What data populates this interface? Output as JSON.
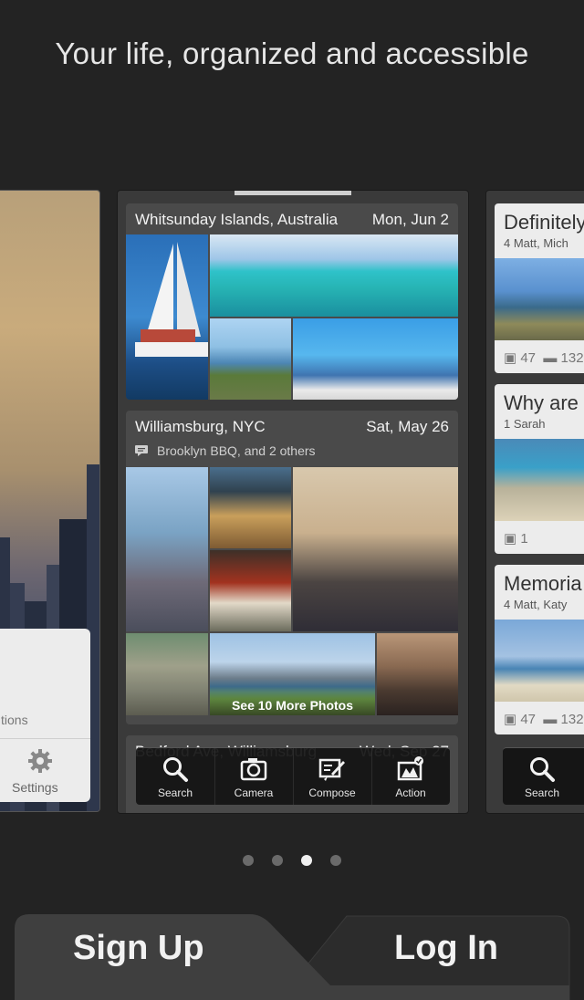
{
  "headline": "Your life, organized and accessible",
  "left_card": {
    "menu_partial_label": "tions",
    "settings_label": "Settings"
  },
  "moments": [
    {
      "location": "Whitsunday Islands, Australia",
      "date": "Mon, Jun 2"
    },
    {
      "location": "Williamsburg, NYC",
      "date": "Sat, May 26",
      "subtitle": "Brooklyn BBQ, and 2 others",
      "more_label": "See 10 More Photos"
    },
    {
      "location": "Bedford Ave, Williamsburg",
      "date": "Wed, Sep 27"
    }
  ],
  "toolbar": {
    "items": [
      {
        "label": "Search",
        "icon": "search-icon"
      },
      {
        "label": "Camera",
        "icon": "camera-icon"
      },
      {
        "label": "Compose",
        "icon": "compose-icon"
      },
      {
        "label": "Action",
        "icon": "action-icon"
      }
    ]
  },
  "right_card": {
    "tiles": [
      {
        "title": "Definitely",
        "people": "4  Matt, Mich",
        "photos": "47",
        "comments": "132"
      },
      {
        "title": "Why are",
        "people": "1  Sarah",
        "photos": "1"
      },
      {
        "title": "Memoria",
        "people": "4  Matt, Katy",
        "photos": "47",
        "comments": "132"
      }
    ],
    "search_label": "Search"
  },
  "pagination": {
    "total": 4,
    "active_index": 2
  },
  "tabs": {
    "signup_label": "Sign Up",
    "login_label": "Log In"
  },
  "colors": {
    "background": "#232323",
    "card_dark": "#3a3a3a",
    "moment_bg": "#4a4a4a",
    "signup_tab": "#3f3f3f",
    "login_tab": "#2c2c2c",
    "dot_active": "#f0f0f0",
    "dot_inactive": "#6a6a6a"
  }
}
